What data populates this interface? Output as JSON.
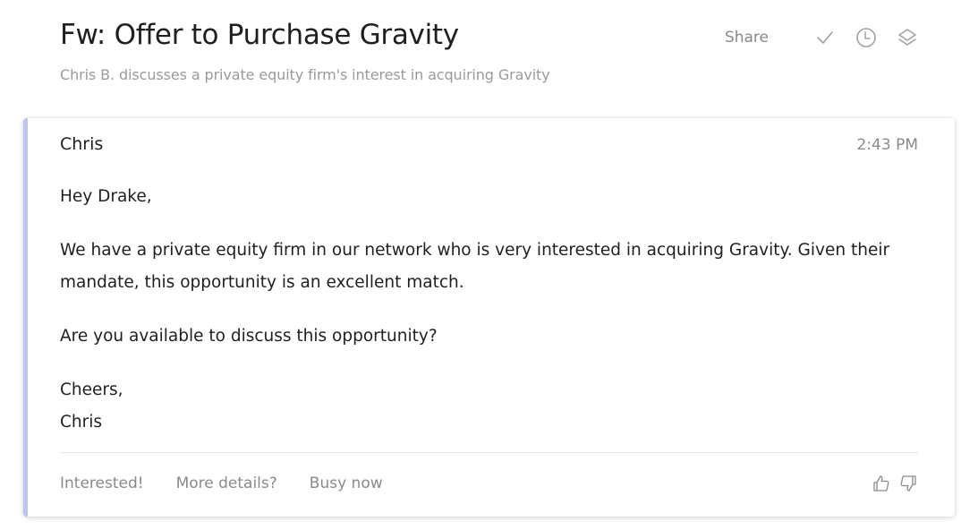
{
  "header": {
    "title": "Fw: Offer to Purchase Gravity",
    "subtitle": "Chris B. discusses a private equity firm's interest in acquiring Gravity",
    "share_label": "Share",
    "icons": [
      "check-icon",
      "clock-icon",
      "layers-icon"
    ]
  },
  "message": {
    "sender": "Chris",
    "time": "2:43 PM",
    "greeting": "Hey Drake,",
    "paragraph_1": "We have a private equity firm in our network who is very interested in acquiring Gravity. Given their mandate, this opportunity is an excellent match.",
    "paragraph_2": "Are you available to discuss this opportunity?",
    "signoff": "Cheers,",
    "signature": "Chris"
  },
  "quick_replies": [
    "Interested!",
    "More details?",
    "Busy now"
  ],
  "feedback_icons": [
    "thumbs-up-icon",
    "thumbs-down-icon"
  ],
  "colors": {
    "accent_bar": "#bfc4ec",
    "muted_text": "#8a8a8a",
    "subtitle_text": "#9a9a9a",
    "body_text": "#1f1f1f"
  }
}
